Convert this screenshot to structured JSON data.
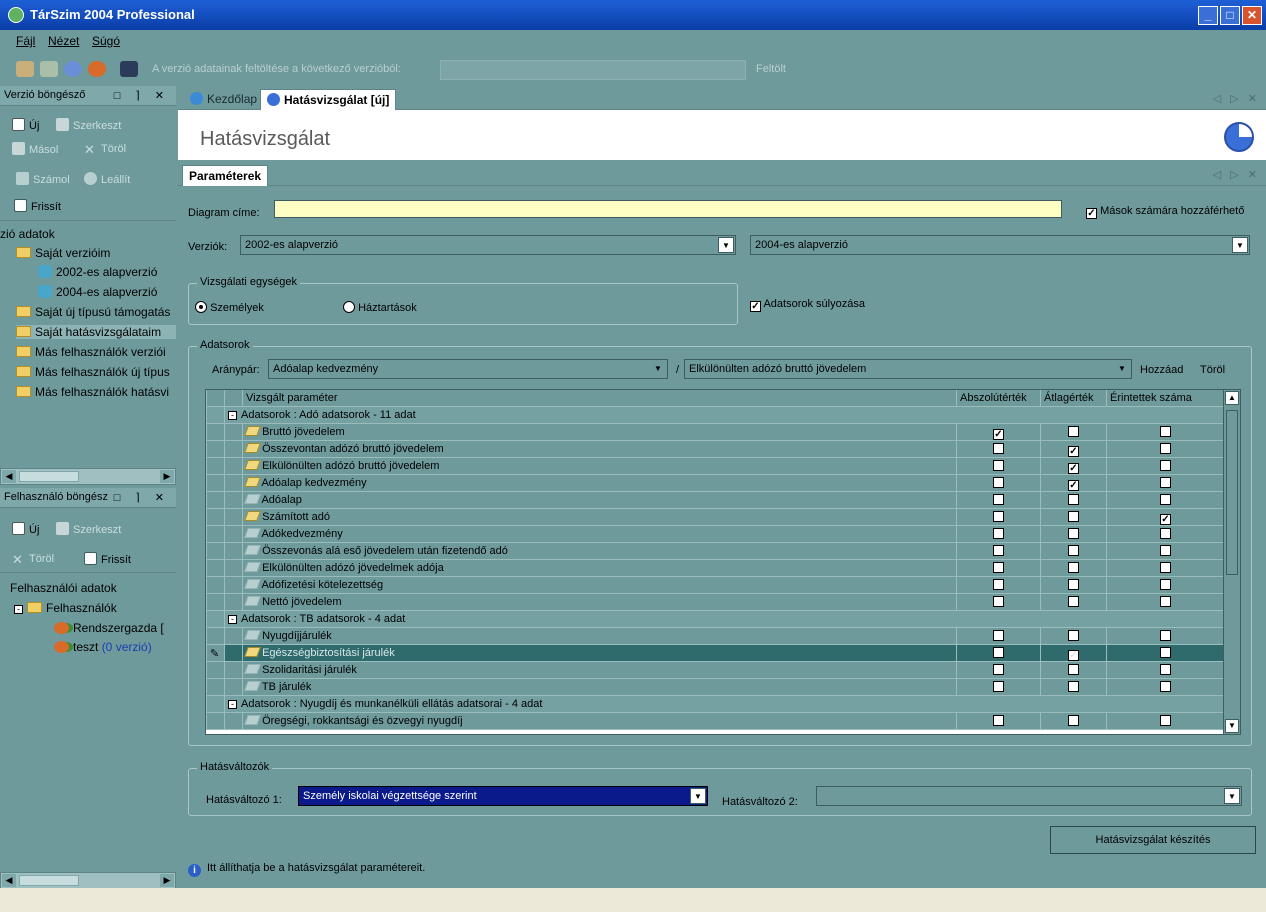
{
  "window": {
    "title": "TárSzim 2004 Professional",
    "min": "_",
    "max": "□",
    "close": "✕"
  },
  "menu": [
    "Fájl",
    "Nézet",
    "Súgó"
  ],
  "toolbar": {
    "text": "A verzió adatainak feltöltése a következő verzióból:",
    "combo_value": "",
    "upload": "Feltölt"
  },
  "version_browser": {
    "title": "Verzió böngésző",
    "buttons": {
      "new": "Új",
      "edit": "Szerkeszt",
      "copy": "Másol",
      "delete": "Töröl",
      "calc": "Számol",
      "stop": "Leállít",
      "refresh": "Frissít"
    },
    "tree": {
      "root": "zió adatok",
      "items": [
        "Saját verzióim",
        "2002-es alapverzió",
        "2004-es alapverzió",
        "Saját új típusú támogatás",
        "Saját hatásvizsgálataim",
        "Más felhasználók verziói",
        "Más felhasználók új típus",
        "Más felhasználók hatásvi"
      ]
    }
  },
  "user_browser": {
    "title": "Felhasználó böngész",
    "buttons": {
      "new": "Új",
      "edit": "Szerkeszt",
      "delete": "Töröl",
      "refresh": "Frissít"
    },
    "tree": {
      "root": "Felhasználói adatok",
      "users_folder": "Felhasználók",
      "user1": "Rendszergazda [",
      "user2": "teszt",
      "user2_suffix": "(0 verzió)"
    }
  },
  "panel_buttons": "□ ⌉ ✕",
  "tabs": {
    "home": "Kezdőlap",
    "active": "Hatásvizsgálat [új]",
    "nav": "◁ ▷ ✕"
  },
  "page": {
    "title": "Hatásvizsgálat",
    "subtab": "Paraméterek"
  },
  "form": {
    "diagram_label": "Diagram címe:",
    "diagram_value": "",
    "others_access": "Mások számára hozzáférhető",
    "versions_label": "Verziók:",
    "version1": "2002-es alapverzió",
    "version2": "2004-es alapverzió",
    "units_group": "Vizsgálati egységek",
    "persons": "Személyek",
    "households": "Háztartások",
    "weighting": "Adatsorok súlyozása",
    "datasets_group": "Adatsorok",
    "ratio_label": "Aránypár:",
    "ratio1": "Adóalap kedvezmény",
    "slash": "/",
    "ratio2": "Elkülönülten adózó bruttó jövedelem",
    "add": "Hozzáad",
    "remove": "Töröl"
  },
  "grid": {
    "columns": [
      "Vizsgált paraméter",
      "Abszolútérték",
      "Átlagérték",
      "Érintettek száma"
    ],
    "rows": [
      {
        "type": "group",
        "label": "Adatsorok : Adó adatsorok - 11 adat"
      },
      {
        "type": "item",
        "label": "Bruttó jövedelem",
        "icon": "full",
        "abs": true,
        "avg": false,
        "cnt": false
      },
      {
        "type": "item",
        "label": "Összevontan adózó bruttó jövedelem",
        "icon": "full",
        "abs": false,
        "avg": true,
        "cnt": false
      },
      {
        "type": "item",
        "label": "Elkülönülten adózó bruttó jövedelem",
        "icon": "full",
        "abs": false,
        "avg": true,
        "cnt": false
      },
      {
        "type": "item",
        "label": "Adóalap kedvezmény",
        "icon": "full",
        "abs": false,
        "avg": true,
        "cnt": false
      },
      {
        "type": "item",
        "label": "Adóalap",
        "icon": "empty",
        "abs": false,
        "avg": false,
        "cnt": false
      },
      {
        "type": "item",
        "label": "Számított adó",
        "icon": "full",
        "abs": false,
        "avg": false,
        "cnt": true
      },
      {
        "type": "item",
        "label": "Adókedvezmény",
        "icon": "empty",
        "abs": false,
        "avg": false,
        "cnt": false
      },
      {
        "type": "item",
        "label": "Összevonás alá eső jövedelem után fizetendő adó",
        "icon": "empty",
        "abs": false,
        "avg": false,
        "cnt": false
      },
      {
        "type": "item",
        "label": "Elkülönülten adózó jövedelmek adója",
        "icon": "empty",
        "abs": false,
        "avg": false,
        "cnt": false
      },
      {
        "type": "item",
        "label": "Adófizetési kötelezettség",
        "icon": "empty",
        "abs": false,
        "avg": false,
        "cnt": false
      },
      {
        "type": "item",
        "label": "Nettó jövedelem",
        "icon": "empty",
        "abs": false,
        "avg": false,
        "cnt": false
      },
      {
        "type": "group",
        "label": "Adatsorok : TB adatsorok - 4 adat"
      },
      {
        "type": "item",
        "label": "Nyugdíjjárulék",
        "icon": "empty",
        "abs": false,
        "avg": false,
        "cnt": false
      },
      {
        "type": "item",
        "label": "Egészségbiztosítási járulék",
        "icon": "full",
        "abs": false,
        "avg": true,
        "cnt": false,
        "selected": true
      },
      {
        "type": "item",
        "label": "Szolidaritási járulék",
        "icon": "empty",
        "abs": false,
        "avg": false,
        "cnt": false
      },
      {
        "type": "item",
        "label": "TB járulék",
        "icon": "empty",
        "abs": false,
        "avg": false,
        "cnt": false
      },
      {
        "type": "group",
        "label": "Adatsorok : Nyugdíj és munkanélküli ellátás adatsorai - 4 adat"
      },
      {
        "type": "item",
        "label": "Öregségi, rokkantsági és özvegyi nyugdíj",
        "icon": "empty",
        "abs": false,
        "avg": false,
        "cnt": false
      }
    ]
  },
  "effects": {
    "group": "Hatásváltozók",
    "label1": "Hatásváltozó 1:",
    "value1": "Személy iskolai végzettsége szerint",
    "label2": "Hatásváltozó 2:",
    "value2": ""
  },
  "make_button": "Hatásvizsgálat készítés",
  "info_text": "Itt állíthatja be a hatásvizsgálat paramétereit."
}
